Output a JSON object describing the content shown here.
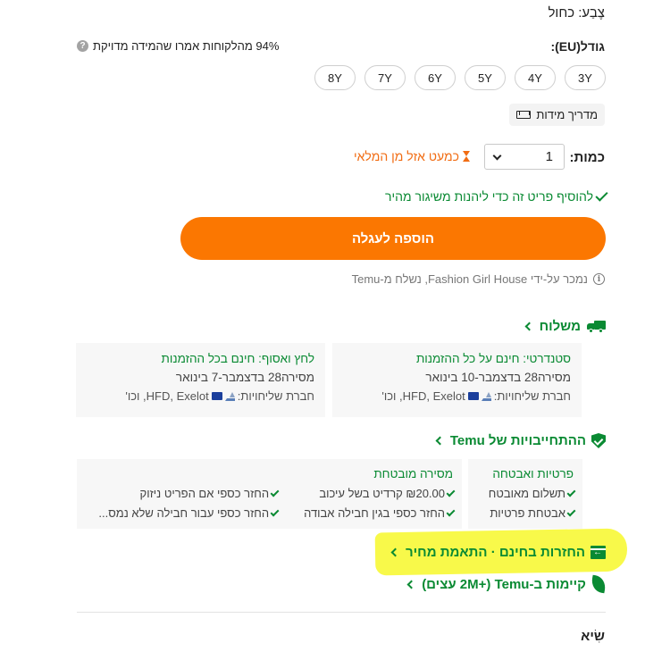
{
  "color": {
    "label": "צֶבַע: כחול"
  },
  "size": {
    "label": "גודל(EU):",
    "fit_info": "94% מהלקוחות אמרו שהמידה מדויקת",
    "options": [
      "3Y",
      "4Y",
      "5Y",
      "6Y",
      "7Y",
      "8Y"
    ],
    "guide_label": "מדריך מידות"
  },
  "quantity": {
    "label": "כמות:",
    "value": "1",
    "stock_warning": "כמעט אזל מן המלאי"
  },
  "free_shipping_note": "להוסיף פריט זה כדי ליהנות משיגור מהיר",
  "add_to_cart_label": "הוספה לעגלה",
  "seller_line": "נמכר על-ידי Fashion Girl House, נשלח מ-Temu",
  "shipping": {
    "heading": "משלוח",
    "standard": {
      "title": "סטנדרטי: חינם על כל ההזמנות",
      "delivery": "מסירה28 בדצמבר-10 בינואר",
      "carriers_label": "חברת שליחויות:",
      "carriers": "HFD, Exelot, וכו'"
    },
    "express": {
      "title": "לחץ ואסוף: חינם בכל ההזמנות",
      "delivery": "מסירה28 בדצמבר-7 בינואר",
      "carriers_label": "חברת שליחויות:",
      "carriers": "HFD, Exelot, וכו'"
    }
  },
  "commitments": {
    "heading": "ההתחייבויות של Temu",
    "privacy": {
      "title": "פרטיות ואבטחה",
      "items": [
        "תשלום מאובטח",
        "אבטחת פרטיות"
      ]
    },
    "delivery": {
      "title": "מסירה מובטחת",
      "col1": [
        "₪20.00 קרדיט בשל עיכוב",
        "החזר כספי בגין חבילה אבודה"
      ],
      "col2": [
        "החזר כספי אם הפריט ניזוק",
        "החזר כספי עבור חבילה שלא נמס..."
      ]
    }
  },
  "returns_heading": "החזרות בחינם · התאמת מחיר",
  "sustainability_heading": "קיימות ב-Temu (+2M עצים)",
  "next_section_label": "שִׂיא",
  "colors": {
    "accent_orange": "#fb7701",
    "green": "#0a8a33",
    "highlight": "#f8f94a"
  }
}
